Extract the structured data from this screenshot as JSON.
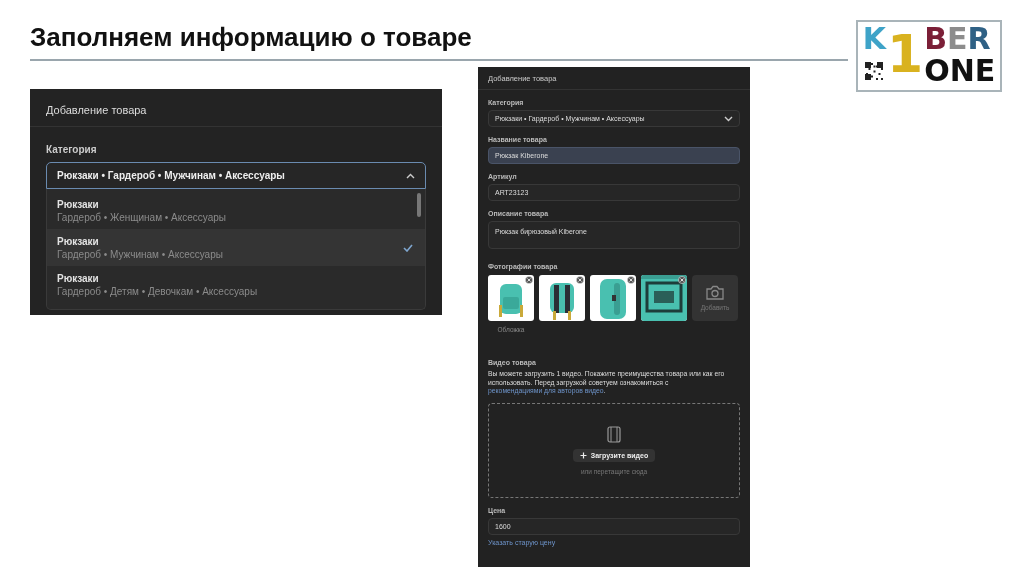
{
  "slide": {
    "title": "Заполняем информацию о товаре"
  },
  "logo": {
    "letters": [
      {
        "text": "K",
        "color": "#3ea3c8"
      },
      {
        "text": "1",
        "color": "#d9b21f"
      },
      {
        "text": "B",
        "color": "#7b1f37"
      },
      {
        "text": "E",
        "color": "#8c8c8c"
      },
      {
        "text": "R",
        "color": "#2f6185"
      }
    ],
    "second_line": "ONE"
  },
  "category_dropdown": {
    "header": "Добавление товара",
    "label": "Категория",
    "value": "Рюкзаки • Гардероб • Мужчинам • Аксессуары",
    "expanded": true,
    "options": [
      {
        "title": "Рюкзаки",
        "path": "Гардероб • Женщинам • Аксессуары",
        "selected": false
      },
      {
        "title": "Рюкзаки",
        "path": "Гардероб • Мужчинам • Аксессуары",
        "selected": true
      },
      {
        "title": "Рюкзаки",
        "path": "Гардероб • Детям • Девочкам • Аксессуары",
        "selected": false
      }
    ]
  },
  "product_form": {
    "header": "Добавление товара",
    "fields": [
      {
        "kind": "select",
        "label": "Категория",
        "value": "Рюкзаки • Гардероб • Мужчинам • Аксессуары",
        "focused": false
      },
      {
        "kind": "text",
        "label": "Название товара",
        "value": "Рюкзак Kiberone",
        "focused": true
      },
      {
        "kind": "text",
        "label": "Артикул",
        "value": "ART23123",
        "focused": false
      },
      {
        "kind": "textarea",
        "label": "Описание товара",
        "value": "Рюкзак бирюзовый Kiberone",
        "focused": false
      }
    ],
    "photos": {
      "label": "Фотографии товара",
      "items": [
        {
          "kind": "picture",
          "caption": "Обложка"
        },
        {
          "kind": "picture"
        },
        {
          "kind": "picture"
        },
        {
          "kind": "picture"
        }
      ],
      "add_label": "Добавить"
    },
    "video": {
      "label": "Видео товара",
      "text": "Вы можете загрузить 1 видео. Покажите преимущества товара или как его использовать. Перед загрузкой советуем ознакомиться с ",
      "link": "рекомендациями для авторов видео",
      "after": ".",
      "button": "Загрузите видео",
      "hint": "или перетащите сюда"
    },
    "price": {
      "label": "Цена",
      "value": "1600",
      "link": "Указать старую цену"
    }
  }
}
